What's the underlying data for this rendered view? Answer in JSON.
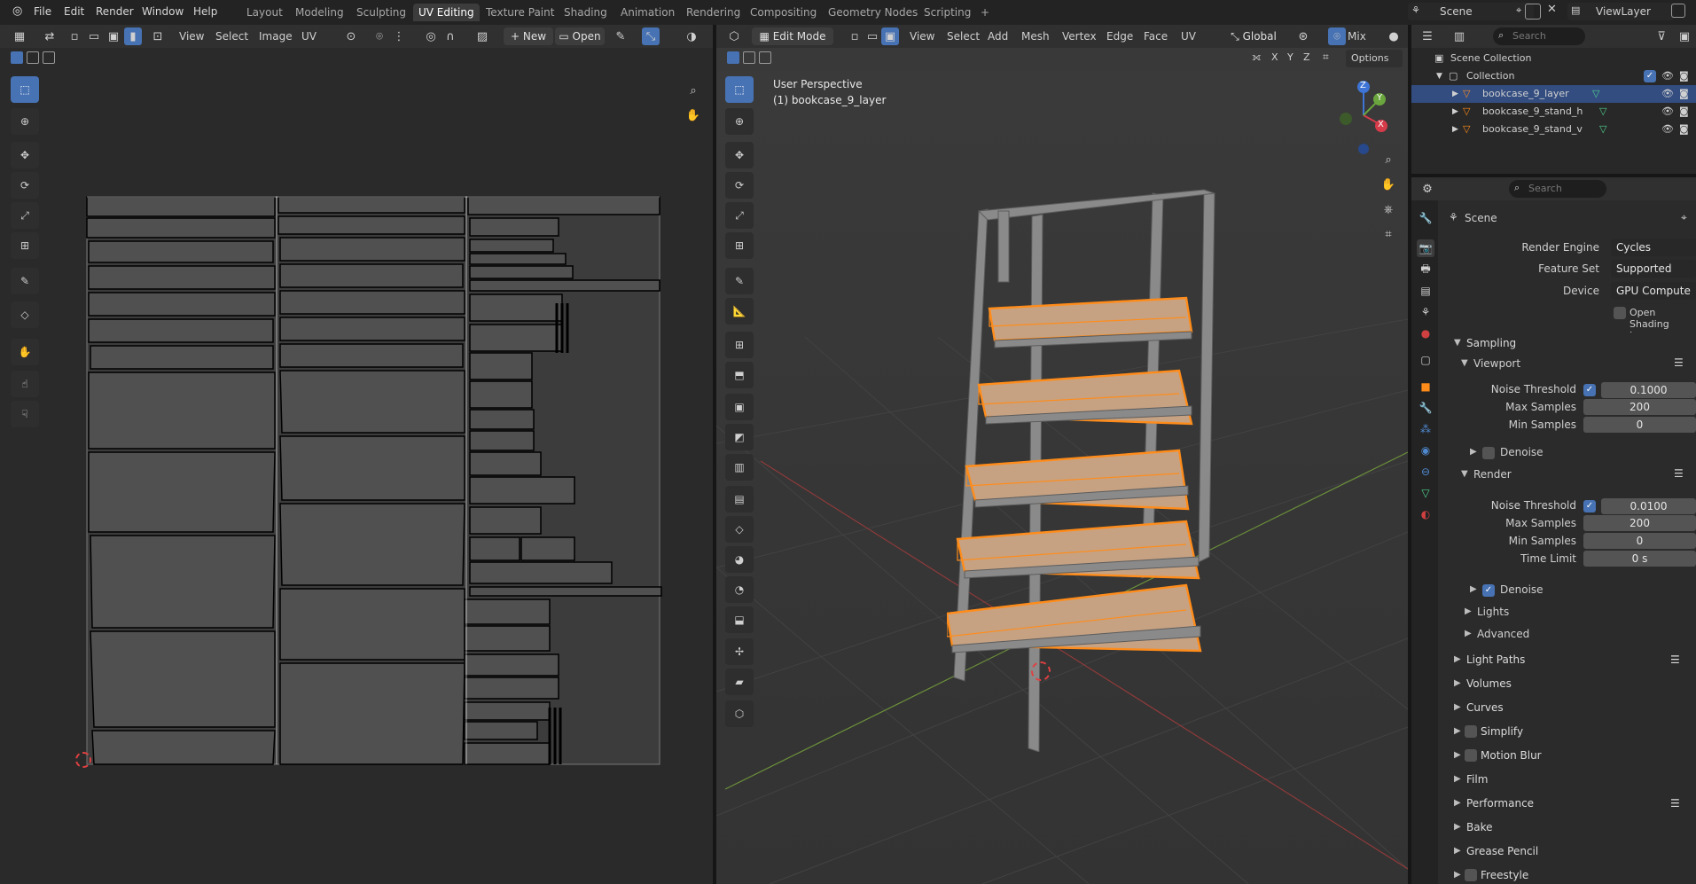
{
  "menus": [
    "File",
    "Edit",
    "Render",
    "Window",
    "Help"
  ],
  "workspaces": [
    "Layout",
    "Modeling",
    "Sculpting",
    "UV Editing",
    "Texture Paint",
    "Shading",
    "Animation",
    "Rendering",
    "Compositing",
    "Geometry Nodes",
    "Scripting"
  ],
  "active_workspace": "UV Editing",
  "add_workspace": "+",
  "scene_name": "Scene",
  "view_layer": "ViewLayer",
  "uv_editor": {
    "header": {
      "view": "View",
      "select": "Select",
      "image": "Image",
      "uv": "UV",
      "new": "New",
      "open": "Open"
    }
  },
  "viewport": {
    "mode": "Edit Mode",
    "menus": [
      "View",
      "Select",
      "Add",
      "Mesh",
      "Vertex",
      "Edge",
      "Face",
      "UV"
    ],
    "orientation": "Global",
    "shading_mix": "Mix",
    "overlay_title": "User Perspective",
    "overlay_object": "(1) bookcase_9_layer",
    "axes": [
      "X",
      "Y",
      "Z"
    ],
    "options": "Options",
    "gizmo": {
      "z": "Z",
      "x": "X",
      "y": "Y"
    }
  },
  "outliner": {
    "search_placeholder": "Search",
    "scene_collection": "Scene Collection",
    "collection": "Collection",
    "objects": [
      "bookcase_9_layer",
      "bookcase_9_stand_h",
      "bookcase_9_stand_v"
    ]
  },
  "properties": {
    "search_placeholder": "Search",
    "context": "Scene",
    "render_engine_label": "Render Engine",
    "render_engine": "Cycles",
    "feature_set_label": "Feature Set",
    "feature_set": "Supported",
    "device_label": "Device",
    "device": "GPU Compute",
    "osl_label": "Open Shading Language",
    "sampling": "Sampling",
    "viewport_sub": "Viewport",
    "render_sub": "Render",
    "noise_threshold_label": "Noise Threshold",
    "viewport_noise": "0.1000",
    "max_samples_label": "Max Samples",
    "viewport_max": "200",
    "min_samples_label": "Min Samples",
    "viewport_min": "0",
    "denoise": "Denoise",
    "render_noise": "0.0100",
    "render_max": "200",
    "render_min": "0",
    "time_limit_label": "Time Limit",
    "time_limit": "0 s",
    "lights": "Lights",
    "advanced": "Advanced",
    "panels": [
      "Light Paths",
      "Volumes",
      "Curves",
      "Simplify",
      "Motion Blur",
      "Film",
      "Performance",
      "Bake",
      "Grease Pencil",
      "Freestyle"
    ]
  },
  "colors": {
    "accent": "#4772b3",
    "selection": "#ff8c1a",
    "bg": "#1d1d1d"
  }
}
